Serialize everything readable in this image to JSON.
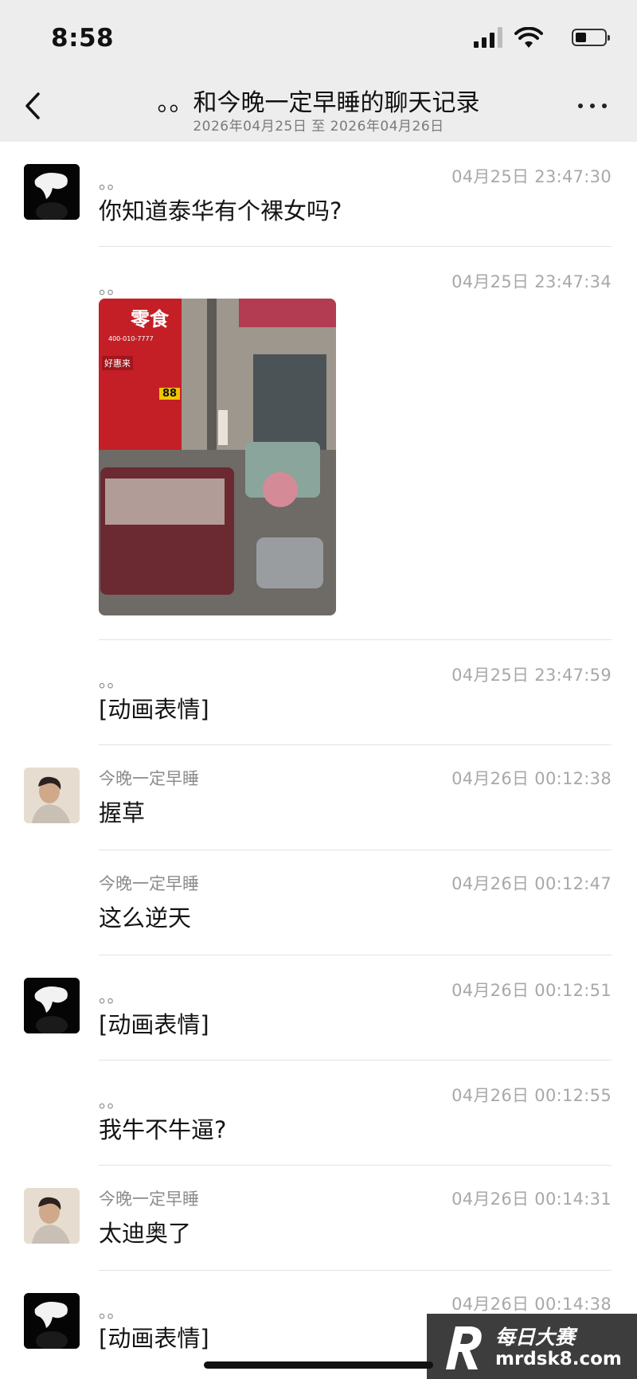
{
  "status_bar": {
    "time": "8:58"
  },
  "header": {
    "title": "。。和今晚一定早睡的聊天记录",
    "subtitle": "2026年04月25日 至 2026年04月26日"
  },
  "messages": [
    {
      "sender": "。。",
      "time": "04月25日 23:47:30",
      "text": "你知道泰华有个裸女吗?",
      "avatar": "dark"
    },
    {
      "sender": "。。",
      "time": "04月25日 23:47:34",
      "text": "",
      "type": "image"
    },
    {
      "sender": "。。",
      "time": "04月25日 23:47:59",
      "text": "[动画表情]"
    },
    {
      "sender": "今晚一定早睡",
      "time": "04月26日 00:12:38",
      "text": "握草",
      "avatar": "photo"
    },
    {
      "sender": "今晚一定早睡",
      "time": "04月26日 00:12:47",
      "text": "这么逆天"
    },
    {
      "sender": "。。",
      "time": "04月26日 00:12:51",
      "text": "[动画表情]",
      "avatar": "dark"
    },
    {
      "sender": "。。",
      "time": "04月26日 00:12:55",
      "text": "我牛不牛逼?"
    },
    {
      "sender": "今晚一定早睡",
      "time": "04月26日 00:14:31",
      "text": "太迪奥了",
      "avatar": "photo"
    },
    {
      "sender": "。。",
      "time": "04月26日 00:14:38",
      "text": "[动画表情]",
      "avatar": "dark"
    }
  ],
  "photo_text": {
    "sign_top": "零食",
    "sign_phone": "400-010-7777",
    "sign_side": "好惠来",
    "price": "88"
  },
  "watermark": {
    "brand": "每日大赛",
    "url": "mrdsk8.com"
  },
  "colors": {
    "header_bg": "#ededed",
    "timestamp": "#a8a8a8",
    "sender": "#8c8c8c"
  }
}
